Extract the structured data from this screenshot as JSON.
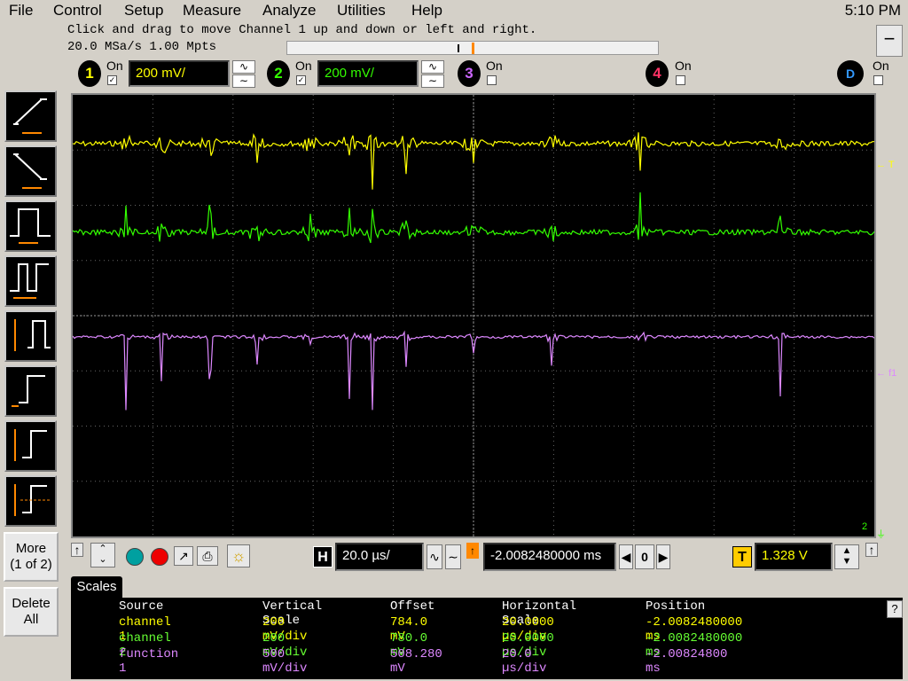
{
  "menu": [
    "File",
    "Control",
    "Setup",
    "Measure",
    "Analyze",
    "Utilities",
    "Help"
  ],
  "clock": "5:10 PM",
  "hint": "Click and drag to move Channel 1 up and down or left and right.",
  "acq": "20.0 MSa/s   1.00 Mpts",
  "minimize_label": "−",
  "channels": [
    {
      "num": "1",
      "on_label": "On",
      "checked": true,
      "scale": "200 mV/",
      "color": "#ffff00"
    },
    {
      "num": "2",
      "on_label": "On",
      "checked": true,
      "scale": "200 mV/",
      "color": "#00ff00"
    },
    {
      "num": "3",
      "on_label": "On",
      "checked": false,
      "color": "#cc66ff"
    },
    {
      "num": "4",
      "on_label": "On",
      "checked": false,
      "color": "#ff3366"
    },
    {
      "num": "D",
      "on_label": "On",
      "checked": false,
      "color": "#3399ff"
    }
  ],
  "side_more": "More\n(1 of 2)",
  "side_delete": "Delete\nAll",
  "markers": {
    "t": "T",
    "f1": "f1",
    "two": "2"
  },
  "horizontal": {
    "label": "H",
    "scale": "20.0 µs/",
    "delay": "-2.0082480000 ms",
    "zero": "0"
  },
  "trigger": {
    "label": "T",
    "level": "1.328 V"
  },
  "tab_label": "Scales",
  "scales_table": {
    "headers": [
      "Source",
      "Vertical Scale",
      "Offset",
      "Horizontal Scale",
      "Position"
    ],
    "rows": [
      {
        "source": "channel 1",
        "vscale": "200 mV/div",
        "offset": "784.0 mV",
        "hscale": "20.0000 µs/div",
        "pos": "-2.0082480000 ms",
        "color": "#ffff00"
      },
      {
        "source": "channel 2",
        "vscale": "200 mV/div",
        "offset": "780.0 mV",
        "hscale": "20.0000 µs/div",
        "pos": "-2.0082480000 ms",
        "color": "#66ff33"
      },
      {
        "source": "function 1",
        "vscale": "500 mV/div",
        "offset": "508.280 mV",
        "hscale": "20.0 µs/div",
        "pos": "-2.00824800 ms",
        "color": "#dd88ff"
      }
    ]
  },
  "help_label": "?",
  "colors": {
    "ch1": "#ffff00",
    "ch2": "#33ff00",
    "f1": "#dd88ff",
    "accent": "#ff8800",
    "grid": "#666666"
  }
}
